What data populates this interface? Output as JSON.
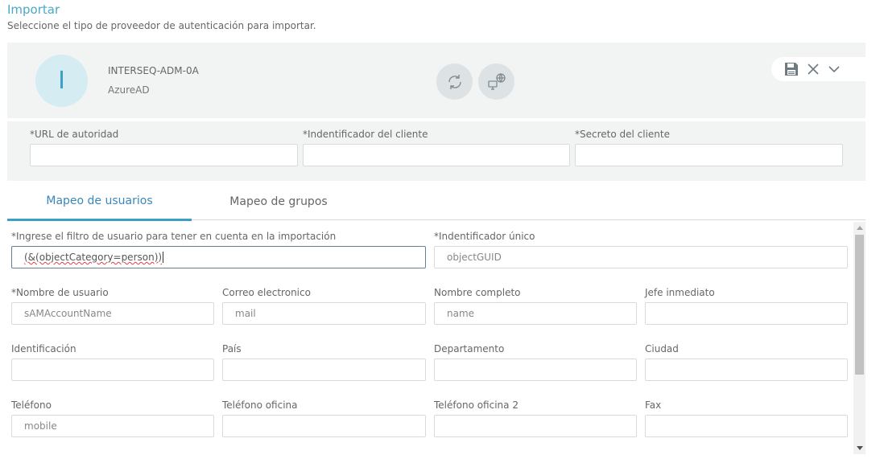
{
  "header": {
    "title": "Importar",
    "subtitle": "Seleccione el tipo de proveedor de autenticación para importar."
  },
  "provider": {
    "avatar_letter": "I",
    "name": "INTERSEQ-ADM-0A",
    "type": "AzureAD",
    "icons": [
      "sync-icon",
      "network-icon",
      "save-icon",
      "close-icon",
      "chevron-down-icon"
    ]
  },
  "credentials": {
    "authority_url_label": "*URL de autoridad",
    "client_id_label": "*Indentificador del cliente",
    "client_secret_label": "*Secreto del cliente",
    "authority_url_value": "",
    "client_id_value": "",
    "client_secret_value": ""
  },
  "tabs": {
    "users": "Mapeo de usuarios",
    "groups": "Mapeo de grupos",
    "active": "users"
  },
  "mapping": {
    "filter_label": "*Ingrese el filtro de usuario para tener en cuenta en la importación",
    "filter_value": "(&(objectCategory=person))",
    "unique_id_label": "*Indentificador único",
    "unique_id_placeholder": "objectGUID",
    "username_label": "*Nombre de usuario",
    "username_placeholder": "sAMAccountName",
    "email_label": "Correo electronico",
    "email_placeholder": "mail",
    "fullname_label": "Nombre completo",
    "fullname_placeholder": "name",
    "manager_label": "Jefe inmediato",
    "manager_placeholder": "",
    "identification_label": "Identificación",
    "country_label": "País",
    "department_label": "Departamento",
    "city_label": "Ciudad",
    "phone_label": "Teléfono",
    "phone_placeholder": "mobile",
    "office_phone_label": "Teléfono oficina",
    "office_phone2_label": "Teléfono oficina 2",
    "fax_label": "Fax"
  },
  "colors": {
    "accent": "#3b9fc6",
    "title": "#4aa8c9",
    "panel": "#f2f4f4"
  }
}
